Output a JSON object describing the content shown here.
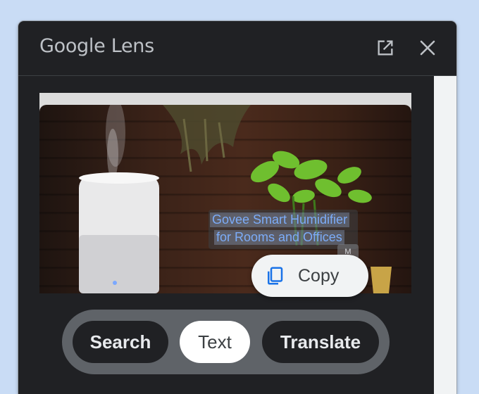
{
  "panel": {
    "title": "Google Lens",
    "open_icon": "open-in-new-icon",
    "close_icon": "close-icon"
  },
  "image": {
    "detected_text": {
      "line1": "Govee Smart Humidifier",
      "line2": "for Rooms and Offices"
    },
    "tag_text": "M"
  },
  "copy_chip": {
    "icon": "copy-icon",
    "label": "Copy"
  },
  "modes": {
    "items": [
      {
        "label": "Search"
      },
      {
        "label": "Text",
        "selected": true
      },
      {
        "label": "Translate"
      }
    ]
  },
  "colors": {
    "panel_bg": "#202124",
    "highlight_text": "#7cacf8",
    "selected_mode_bg": "#ffffff",
    "desktop_bg": "#c9dcf5"
  }
}
